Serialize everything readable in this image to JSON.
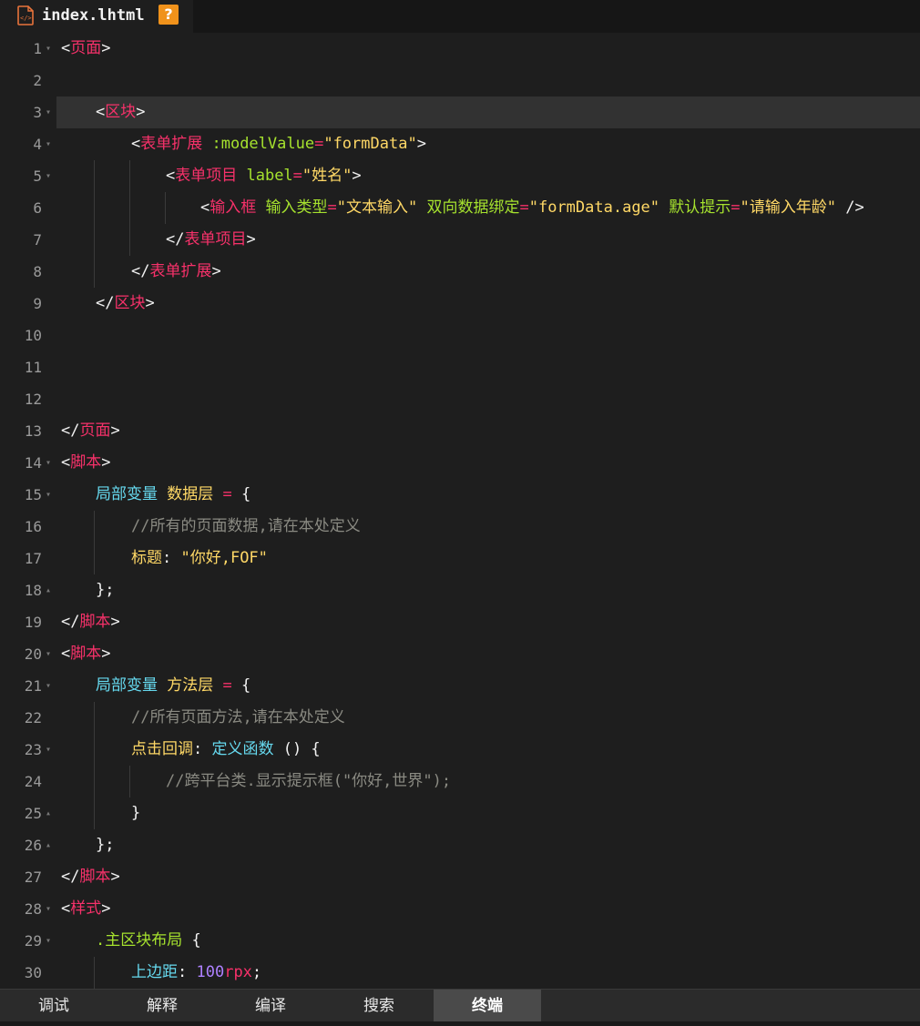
{
  "tab": {
    "file_name": "index.lhtml",
    "help_badge": "?"
  },
  "editor": {
    "lines": [
      {
        "n": "1",
        "fold": true,
        "tokens": [
          [
            "p",
            "<"
          ],
          [
            "tg",
            "页面"
          ],
          [
            "p",
            ">"
          ]
        ]
      },
      {
        "n": "2",
        "fold": false,
        "tokens": []
      },
      {
        "n": "3",
        "fold": true,
        "tokens": [
          [
            "p",
            "<"
          ],
          [
            "tg",
            "区块"
          ],
          [
            "p",
            ">"
          ]
        ]
      },
      {
        "n": "4",
        "fold": true,
        "tokens": [
          [
            "p",
            "<"
          ],
          [
            "tg",
            "表单扩展"
          ],
          [
            "at",
            " :modelValue"
          ],
          [
            "tg",
            "="
          ],
          [
            "st",
            "\"formData\""
          ],
          [
            "p",
            ">"
          ]
        ]
      },
      {
        "n": "5",
        "fold": true,
        "tokens": [
          [
            "p",
            "<"
          ],
          [
            "tg",
            "表单项目"
          ],
          [
            "at",
            " label"
          ],
          [
            "tg",
            "="
          ],
          [
            "st",
            "\"姓名\""
          ],
          [
            "p",
            ">"
          ]
        ]
      },
      {
        "n": "6",
        "fold": false,
        "tokens": [
          [
            "p",
            "<"
          ],
          [
            "tg",
            "输入框"
          ],
          [
            "at",
            " 输入类型"
          ],
          [
            "tg",
            "="
          ],
          [
            "st",
            "\"文本输入\""
          ],
          [
            "at",
            " 双向数据绑定"
          ],
          [
            "tg",
            "="
          ],
          [
            "st",
            "\"formData.age\""
          ],
          [
            "at",
            " 默认提示"
          ],
          [
            "tg",
            "="
          ],
          [
            "st",
            "\"请输入年龄\""
          ],
          [
            "p",
            " />"
          ]
        ]
      },
      {
        "n": "7",
        "fold": false,
        "tokens": [
          [
            "p",
            "</"
          ],
          [
            "tg",
            "表单项目"
          ],
          [
            "p",
            ">"
          ]
        ]
      },
      {
        "n": "8",
        "fold": false,
        "tokens": [
          [
            "p",
            "</"
          ],
          [
            "tg",
            "表单扩展"
          ],
          [
            "p",
            ">"
          ]
        ]
      },
      {
        "n": "9",
        "fold": false,
        "tokens": [
          [
            "p",
            "</"
          ],
          [
            "tg",
            "区块"
          ],
          [
            "p",
            ">"
          ]
        ]
      },
      {
        "n": "10",
        "fold": false,
        "tokens": []
      },
      {
        "n": "11",
        "fold": false,
        "tokens": []
      },
      {
        "n": "12",
        "fold": false,
        "tokens": []
      },
      {
        "n": "13",
        "fold": false,
        "tokens": [
          [
            "p",
            "</"
          ],
          [
            "tg",
            "页面"
          ],
          [
            "p",
            ">"
          ]
        ]
      },
      {
        "n": "14",
        "fold": true,
        "tokens": [
          [
            "p",
            "<"
          ],
          [
            "tg",
            "脚本"
          ],
          [
            "p",
            ">"
          ]
        ]
      },
      {
        "n": "15",
        "fold": true,
        "tokens": [
          [
            "kw",
            "局部变量"
          ],
          [
            "p",
            " "
          ],
          [
            "ob",
            "数据层"
          ],
          [
            "tg",
            " ="
          ],
          [
            "p",
            " {"
          ]
        ]
      },
      {
        "n": "16",
        "fold": false,
        "tokens": [
          [
            "cm",
            "//所有的页面数据,请在本处定义"
          ]
        ]
      },
      {
        "n": "17",
        "fold": false,
        "tokens": [
          [
            "ob",
            "标题"
          ],
          [
            "p",
            ": "
          ],
          [
            "st",
            "\"你好,FOF\""
          ]
        ]
      },
      {
        "n": "18",
        "fold": "up",
        "tokens": [
          [
            "p",
            "};"
          ]
        ]
      },
      {
        "n": "19",
        "fold": false,
        "tokens": [
          [
            "p",
            "</"
          ],
          [
            "tg",
            "脚本"
          ],
          [
            "p",
            ">"
          ]
        ]
      },
      {
        "n": "20",
        "fold": true,
        "tokens": [
          [
            "p",
            "<"
          ],
          [
            "tg",
            "脚本"
          ],
          [
            "p",
            ">"
          ]
        ]
      },
      {
        "n": "21",
        "fold": true,
        "tokens": [
          [
            "kw",
            "局部变量"
          ],
          [
            "p",
            " "
          ],
          [
            "ob",
            "方法层"
          ],
          [
            "tg",
            " ="
          ],
          [
            "p",
            " {"
          ]
        ]
      },
      {
        "n": "22",
        "fold": false,
        "tokens": [
          [
            "cm",
            "//所有页面方法,请在本处定义"
          ]
        ]
      },
      {
        "n": "23",
        "fold": true,
        "tokens": [
          [
            "ob",
            "点击回调"
          ],
          [
            "p",
            ": "
          ],
          [
            "kw",
            "定义函数"
          ],
          [
            "p",
            " () {"
          ]
        ]
      },
      {
        "n": "24",
        "fold": false,
        "tokens": [
          [
            "cm",
            "//跨平台类.显示提示框(\"你好,世界\");"
          ]
        ]
      },
      {
        "n": "25",
        "fold": "up",
        "tokens": [
          [
            "p",
            "}"
          ]
        ]
      },
      {
        "n": "26",
        "fold": "up",
        "tokens": [
          [
            "p",
            "};"
          ]
        ]
      },
      {
        "n": "27",
        "fold": false,
        "tokens": [
          [
            "p",
            "</"
          ],
          [
            "tg",
            "脚本"
          ],
          [
            "p",
            ">"
          ]
        ]
      },
      {
        "n": "28",
        "fold": true,
        "tokens": [
          [
            "p",
            "<"
          ],
          [
            "tg",
            "样式"
          ],
          [
            "p",
            ">"
          ]
        ]
      },
      {
        "n": "29",
        "fold": true,
        "tokens": [
          [
            "fn",
            ".主区块布局"
          ],
          [
            "p",
            " {"
          ]
        ]
      },
      {
        "n": "30",
        "fold": false,
        "tokens": [
          [
            "kw",
            "上边距"
          ],
          [
            "p",
            ": "
          ],
          [
            "nm",
            "100"
          ],
          [
            "un",
            "rpx"
          ],
          [
            "p",
            ";"
          ]
        ]
      }
    ]
  },
  "bottom_tabs": [
    "调试",
    "解释",
    "编译",
    "搜索",
    "终端"
  ],
  "active_bottom_tab": "终端",
  "colors": {
    "tag": "#f7316a",
    "attr": "#a6e22e",
    "string": "#ffd866",
    "keyword": "#66d9ef",
    "comment": "#8a8a82",
    "number": "#ae81ff"
  }
}
